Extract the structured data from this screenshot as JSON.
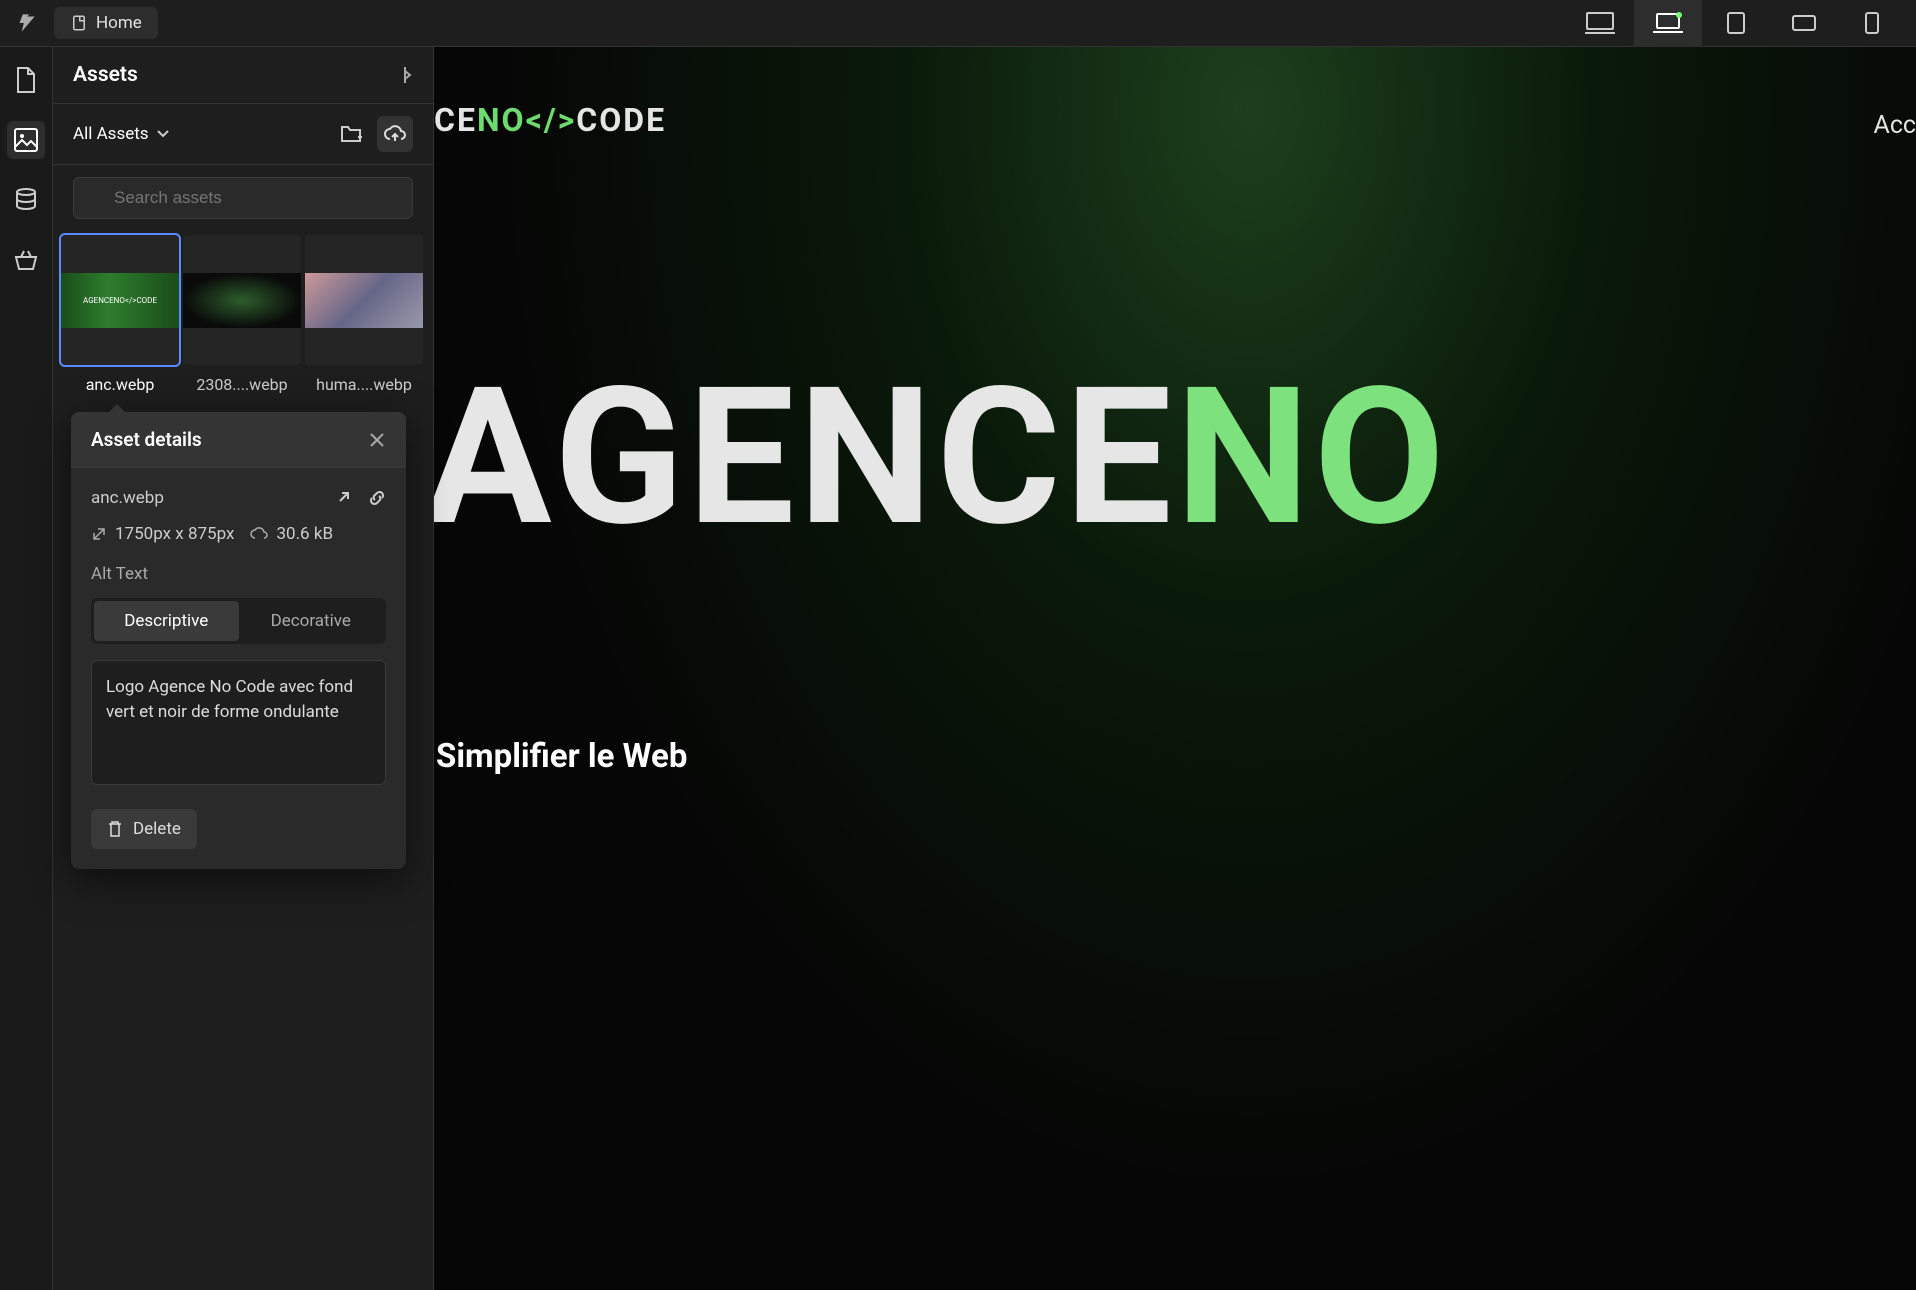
{
  "topbar": {
    "home_label": "Home"
  },
  "panel": {
    "title": "Assets",
    "filter_label": "All Assets",
    "search_placeholder": "Search assets"
  },
  "assets": [
    {
      "label": "anc.webp"
    },
    {
      "label": "2308....webp"
    },
    {
      "label": "huma....webp"
    }
  ],
  "details": {
    "title": "Asset details",
    "filename": "anc.webp",
    "dimensions": "1750px x 875px",
    "filesize": "30.6 kB",
    "alt_label": "Alt Text",
    "seg_descriptive": "Descriptive",
    "seg_decorative": "Decorative",
    "alt_value": "Logo Agence No Code avec fond vert et noir de forme ondulante",
    "delete_label": "Delete"
  },
  "canvas": {
    "logo_small_parts": {
      "p1": "CE",
      "p2": "NO",
      "p3": "</>",
      "p4": "CODE"
    },
    "nav_item": "Acc",
    "big_parts": {
      "p1": "AGENCE",
      "p2": "NO"
    },
    "tagline": "Simplifier le Web"
  }
}
